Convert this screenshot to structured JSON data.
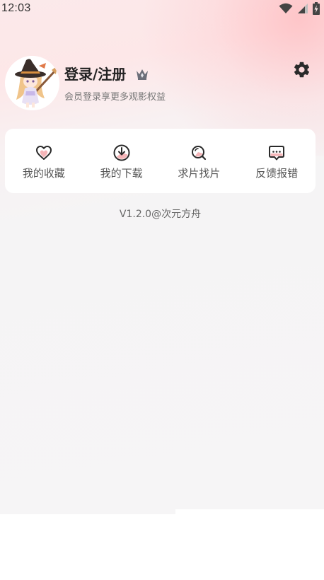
{
  "status_bar": {
    "time": "12:03",
    "icons": [
      "wifi-icon",
      "cellular-signal-icon",
      "battery-charging-icon"
    ]
  },
  "profile": {
    "title": "登录/注册",
    "subtitle": "会员登录享更多观影权益",
    "avatar": "witch-girl-avatar",
    "badge_icon": "crown-icon",
    "settings_icon": "gear-icon"
  },
  "actions": [
    {
      "label": "我的收藏",
      "icon": "heart-icon"
    },
    {
      "label": "我的下载",
      "icon": "download-icon"
    },
    {
      "label": "求片找片",
      "icon": "search-icon"
    },
    {
      "label": "反馈报错",
      "icon": "feedback-icon"
    }
  ],
  "footer": {
    "version": "V1.2.0@次元方舟"
  },
  "colors": {
    "accent_pink": "#f5b5b8",
    "icon_dark": "#2a2a2a",
    "card_bg": "#ffffff",
    "page_bg": "#f6f5f6"
  }
}
